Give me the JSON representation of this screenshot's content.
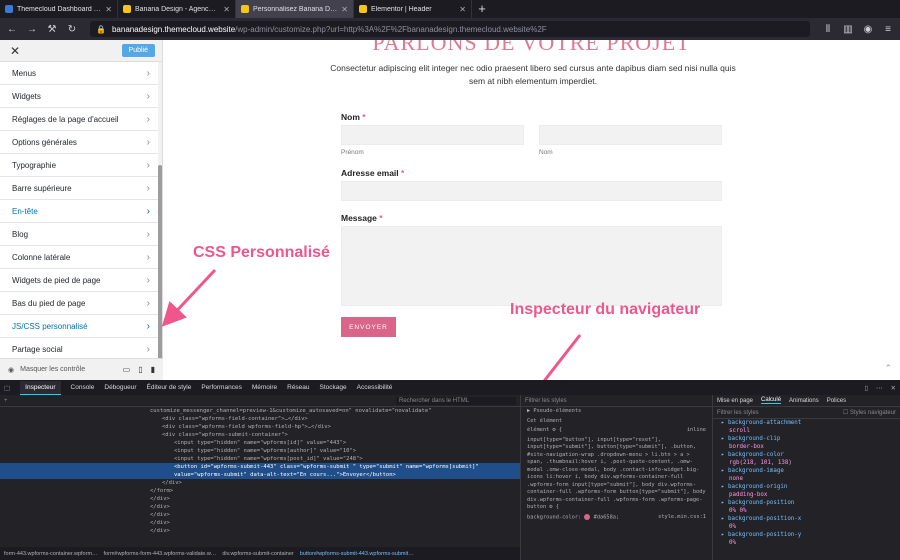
{
  "browser": {
    "tabs": [
      {
        "title": "Themecloud Dashboard - My w",
        "active": false,
        "color": "#3a7bd5"
      },
      {
        "title": "Banana Design - Agence Word",
        "active": false,
        "color": "#f5c518"
      },
      {
        "title": "Personnalisez Banana Design -",
        "active": true,
        "color": "#f5c518"
      },
      {
        "title": "Elementor | Header",
        "active": false,
        "color": "#f5c518"
      }
    ],
    "new_tab": "+",
    "url_host": "bananadesign.themecloud.website",
    "url_path": "/wp-admin/customize.php?url=http%3A%2F%2Fbananadesign.themecloud.website%2F"
  },
  "customizer": {
    "publish_label": "Publié",
    "close_label": "✕",
    "items": [
      {
        "label": "Menus",
        "highlight": false
      },
      {
        "label": "Widgets",
        "highlight": false
      },
      {
        "label": "Réglages de la page d'accueil",
        "highlight": false
      },
      {
        "label": "Options générales",
        "highlight": false
      },
      {
        "label": "Typographie",
        "highlight": false
      },
      {
        "label": "Barre supérieure",
        "highlight": false
      },
      {
        "label": "En-tête",
        "highlight": true
      },
      {
        "label": "Blog",
        "highlight": false
      },
      {
        "label": "Colonne latérale",
        "highlight": false
      },
      {
        "label": "Widgets de pied de page",
        "highlight": false
      },
      {
        "label": "Bas du pied de page",
        "highlight": false
      },
      {
        "label": "JS/CSS personnalisé",
        "highlight": true
      },
      {
        "label": "Partage social",
        "highlight": false
      }
    ],
    "footer_label": "Masquer les contrôle"
  },
  "preview": {
    "heading": "PARLONS DE VOTRE PROJET",
    "lead": "Consectetur adipiscing elit integer nec odio praesent libero sed cursus ante dapibus diam sed nisi nulla quis sem at nibh elementum imperdiet.",
    "name_label": "Nom",
    "first_label": "Prénom",
    "last_label": "Nom",
    "email_label": "Adresse email",
    "message_label": "Message",
    "required_mark": "*",
    "submit_label": "ENVOYER"
  },
  "annotations": {
    "css": "CSS Personnalisé",
    "inspector": "Inspecteur du navigateur"
  },
  "devtools": {
    "tabs": [
      "Inspecteur",
      "Console",
      "Débogueur",
      "Éditeur de style",
      "Performances",
      "Mémoire",
      "Réseau",
      "Stockage",
      "Accessibilité"
    ],
    "search_placeholder": "Rechercher dans le HTML",
    "html_lines": [
      {
        "indent": 0,
        "text": "customize_messenger_channel=preview-1&customize_autosaved=on\" novalidate=\"novalidate\"",
        "sel": false
      },
      {
        "indent": 1,
        "text": "<div class=\"wpforms-field-container\">…</div>",
        "sel": false
      },
      {
        "indent": 1,
        "text": "<div class=\"wpforms-field wpforms-field-hp\">…</div>",
        "sel": false
      },
      {
        "indent": 1,
        "text": "<div class=\"wpforms-submit-container\">",
        "sel": false
      },
      {
        "indent": 2,
        "text": "<input type=\"hidden\" name=\"wpforms[id]\" value=\"443\">",
        "sel": false
      },
      {
        "indent": 2,
        "text": "<input type=\"hidden\" name=\"wpforms[author]\" value=\"10\">",
        "sel": false
      },
      {
        "indent": 2,
        "text": "<input type=\"hidden\" name=\"wpforms[post_id]\" value=\"248\">",
        "sel": false
      },
      {
        "indent": 2,
        "text": "<button id=\"wpforms-submit-443\" class=\"wpforms-submit \" type=\"submit\" name=\"wpforms[submit]\"",
        "sel": true
      },
      {
        "indent": 2,
        "text": "value=\"wpforms-submit\" data-alt-text=\"En cours...\">Envoyer</button>",
        "sel": true
      },
      {
        "indent": 1,
        "text": "</div>",
        "sel": false
      },
      {
        "indent": 0,
        "text": "</form>",
        "sel": false
      },
      {
        "indent": 0,
        "text": "</div>",
        "sel": false
      },
      {
        "indent": 0,
        "text": "</div>",
        "sel": false
      },
      {
        "indent": 0,
        "text": "</div>",
        "sel": false
      },
      {
        "indent": 0,
        "text": "</div>",
        "sel": false
      },
      {
        "indent": 0,
        "text": "</div>",
        "sel": false
      }
    ],
    "breadcrumb": [
      "form-443.wpforms-container.wpform…",
      "form#wpforms-form-443.wpforms-validate.w…",
      "div.wpforms-submit-container",
      "button#wpforms-submit-443.wpforms-submit…"
    ],
    "rules_filter": "Filtrer les styles",
    "rules_pseudo": "Pseudo-éléments",
    "rules_this": "Cet élément",
    "rules_element": "élément ⚙ {",
    "rules_inline": "inline",
    "rules_selector": "input[type=\"button\"], input[type=\"reset\"], input[type=\"submit\"], button[type=\"submit\"], .button, #site-navigation-wrap .dropdown-menu > li.btn > a > span, .thumbnail:hover i, .post-quote-content, .omw-modal .omw-close-modal, body .contact-info-widget.big-icons li:hover i, body div.wpforms-container-full .wpforms-form input[type=\"submit\"], body div.wpforms-container-full .wpforms-form button[type=\"submit\"], body div.wpforms-container-full .wpforms-form .wpforms-page-button ⚙ {",
    "rules_decl": "background-color:",
    "rules_value": "#da658a;",
    "rules_file": "style.min.css:1",
    "side_tabs": [
      "Mise en page",
      "Calculé",
      "Animations",
      "Polices"
    ],
    "side_filter": "Filtrer les styles",
    "side_browser": "Styles navigateur",
    "props": [
      {
        "name": "background-attachment",
        "value": "scroll"
      },
      {
        "name": "background-clip",
        "value": "border-box"
      },
      {
        "name": "background-color",
        "value": "rgb(218, 101, 138)"
      },
      {
        "name": "background-image",
        "value": "none"
      },
      {
        "name": "background-origin",
        "value": "padding-box"
      },
      {
        "name": "background-position",
        "value": "0% 0%"
      },
      {
        "name": "background-position-x",
        "value": "0%"
      },
      {
        "name": "background-position-y",
        "value": "0%"
      }
    ],
    "accent": "#da658a"
  }
}
